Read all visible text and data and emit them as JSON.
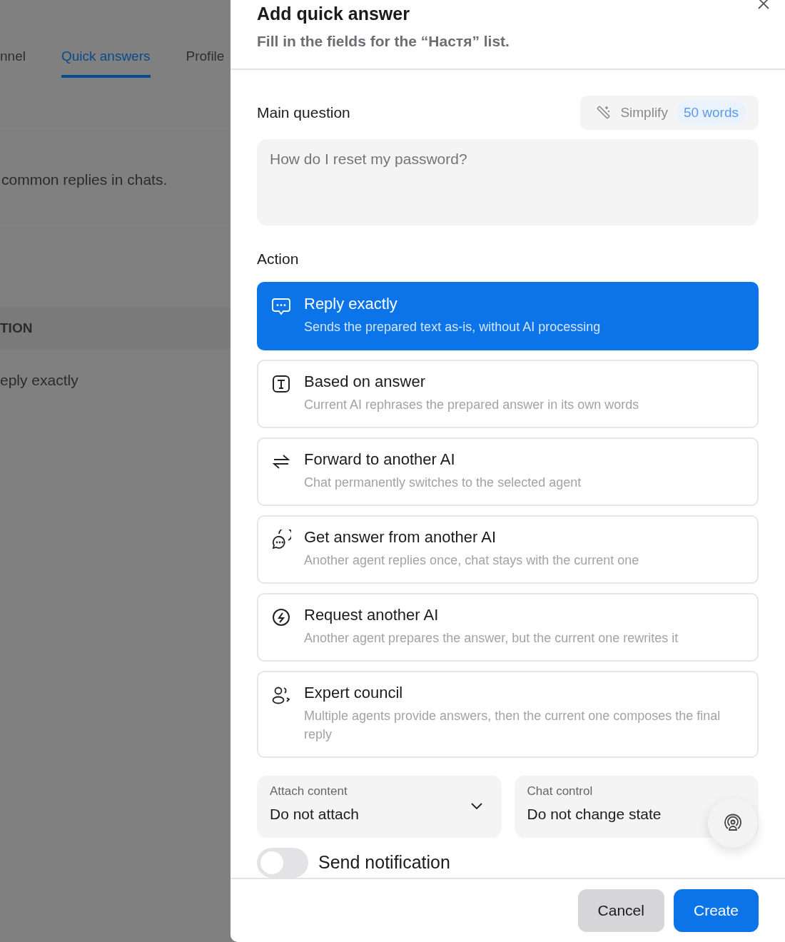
{
  "background_page": {
    "tabs": [
      {
        "label": "nnel",
        "selected": false
      },
      {
        "label": "Quick answers",
        "selected": true
      },
      {
        "label": "Profile",
        "selected": false
      }
    ],
    "description": "common replies in chats.",
    "section_header": "TION",
    "row_value": "eply exactly"
  },
  "dialog": {
    "title": "Add quick answer",
    "subtitle": "Fill in the fields for the “Настя” list.",
    "main_question": {
      "label": "Simplify",
      "heading": "Main question",
      "word_count": "50 words",
      "placeholder": "How do I reset my password?"
    },
    "action": {
      "heading": "Action",
      "options": [
        {
          "title": "Reply exactly",
          "description": "Sends the prepared text as-is, without AI processing",
          "selected": true
        },
        {
          "title": "Based on answer",
          "description": "Current AI rephrases the prepared answer in its own words",
          "selected": false
        },
        {
          "title": "Forward to another AI",
          "description": "Chat permanently switches to the selected agent",
          "selected": false
        },
        {
          "title": "Get answer from another AI",
          "description": "Another agent replies once, chat stays with the current one",
          "selected": false
        },
        {
          "title": "Request another AI",
          "description": "Another agent prepares the answer, but the current one rewrites it",
          "selected": false
        },
        {
          "title": "Expert council",
          "description": "Multiple agents provide answers, then the current one composes the final reply",
          "selected": false
        }
      ]
    },
    "selects": [
      {
        "label": "Attach content",
        "value": "Do not attach"
      },
      {
        "label": "Chat control",
        "value": "Do not change state"
      }
    ],
    "send_notification": {
      "label": "Send notification",
      "on": false
    },
    "buttons": [
      {
        "label": "Cancel",
        "kind": "secondary"
      },
      {
        "label": "Create",
        "kind": "primary"
      }
    ]
  }
}
